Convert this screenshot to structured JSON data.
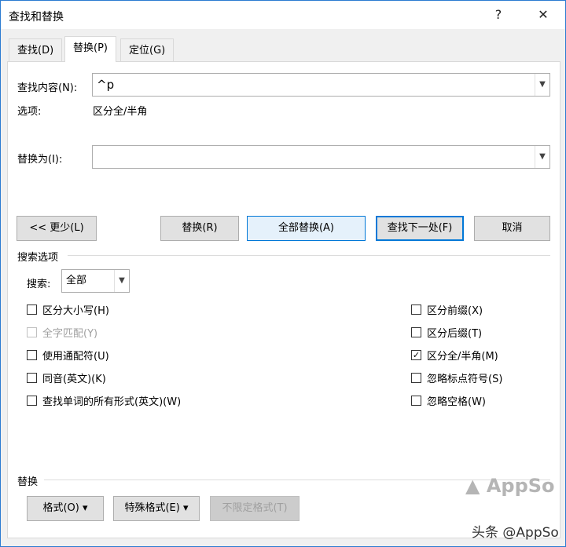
{
  "title": "查找和替换",
  "title_buttons": {
    "help": "?",
    "close": "✕"
  },
  "tabs": [
    {
      "label": "查找(D)"
    },
    {
      "label": "替换(P)"
    },
    {
      "label": "定位(G)"
    }
  ],
  "find": {
    "label": "查找内容(N):",
    "value": "^p"
  },
  "options": {
    "label": "选项:",
    "value": "区分全/半角"
  },
  "replace": {
    "label": "替换为(I):",
    "value": ""
  },
  "buttons": {
    "less": "<< 更少(L)",
    "replace": "替换(R)",
    "replace_all": "全部替换(A)",
    "find_next": "查找下一处(F)",
    "cancel": "取消"
  },
  "search_options": {
    "heading": "搜索选项",
    "search_label": "搜索:",
    "search_value": "全部"
  },
  "checkboxes_left": [
    {
      "label": "区分大小写(H)",
      "checked": false,
      "disabled": false
    },
    {
      "label": "全字匹配(Y)",
      "checked": false,
      "disabled": true
    },
    {
      "label": "使用通配符(U)",
      "checked": false,
      "disabled": false
    },
    {
      "label": "同音(英文)(K)",
      "checked": false,
      "disabled": false
    },
    {
      "label": "查找单词的所有形式(英文)(W)",
      "checked": false,
      "disabled": false
    }
  ],
  "checkboxes_right": [
    {
      "label": "区分前缀(X)",
      "checked": false
    },
    {
      "label": "区分后缀(T)",
      "checked": false
    },
    {
      "label": "区分全/半角(M)",
      "checked": true
    },
    {
      "label": "忽略标点符号(S)",
      "checked": false
    },
    {
      "label": "忽略空格(W)",
      "checked": false
    }
  ],
  "replace_section": {
    "heading": "替换",
    "format": "格式(O) ▾",
    "special": "特殊格式(E) ▾",
    "no_format": "不限定格式(T)"
  },
  "watermark": {
    "brand": "AppSo",
    "credit": "头条 @AppSo"
  }
}
